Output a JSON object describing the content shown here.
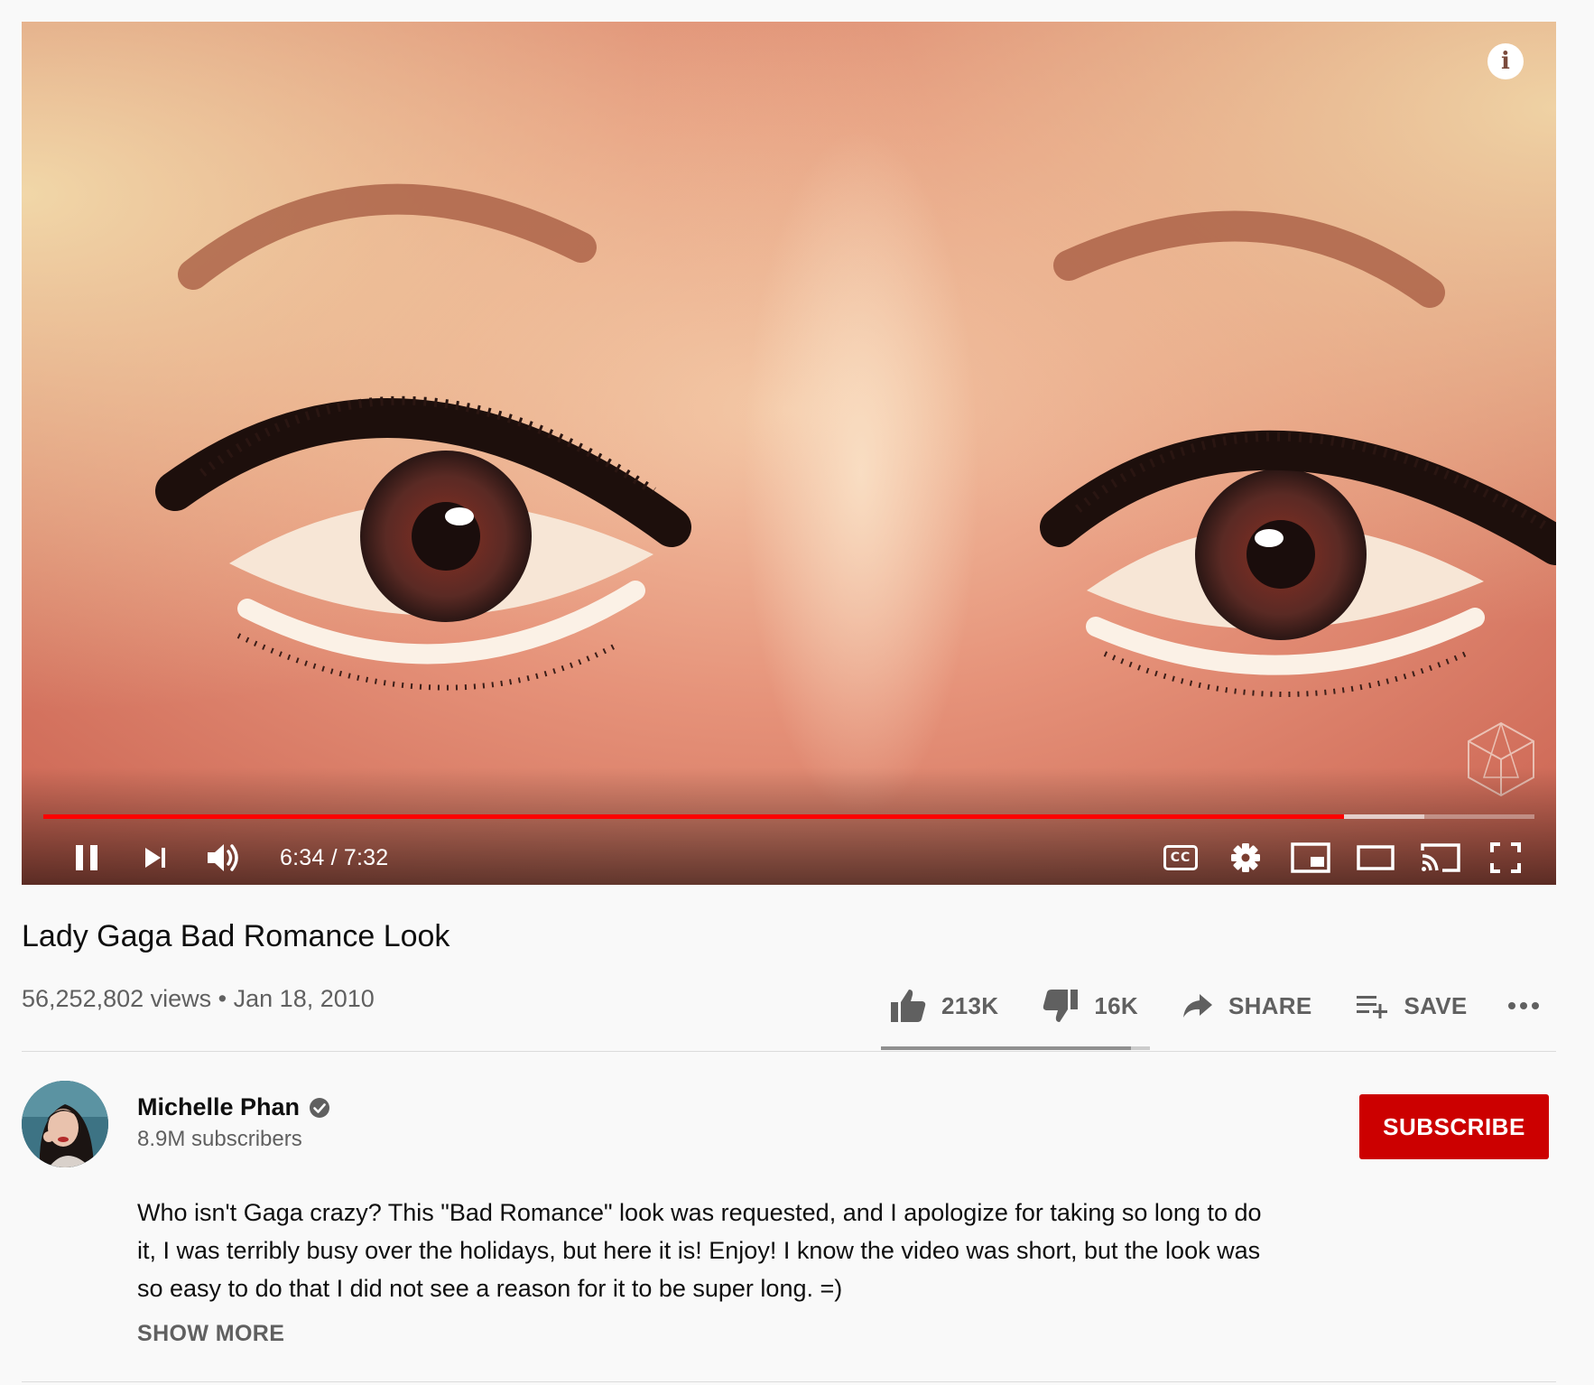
{
  "player": {
    "current_time": "6:34",
    "duration": "7:32",
    "time_display": "6:34 / 7:32",
    "played_fraction": 0.872,
    "buffered_fraction": 0.926,
    "icons": [
      "info-icon",
      "pause-icon",
      "next-icon",
      "volume-icon",
      "cc-icon",
      "settings-icon",
      "miniplayer-icon",
      "theater-icon",
      "cast-icon",
      "fullscreen-icon"
    ],
    "cc_label": "CC",
    "info_glyph": "i",
    "accent": "#ff0000"
  },
  "video": {
    "title": "Lady Gaga Bad Romance Look",
    "views": "56,252,802 views",
    "separator": "•",
    "date": "Jan 18, 2010"
  },
  "actions": {
    "likes": "213K",
    "dislikes": "16K",
    "share": "SHARE",
    "save": "SAVE",
    "like_fraction": 0.93
  },
  "channel": {
    "name": "Michelle Phan",
    "subscribers": "8.9M subscribers",
    "subscribe_label": "SUBSCRIBE",
    "subscribe_color": "#cc0000"
  },
  "description": {
    "text": "Who isn't Gaga crazy? This \"Bad Romance\" look was requested, and I apologize for taking so long to do it, I was terribly busy over the holidays, but here it is! Enjoy! I know the video was short, but the look was so easy to do that I did not see a reason for it to be super long. =)",
    "show_more": "SHOW MORE"
  }
}
